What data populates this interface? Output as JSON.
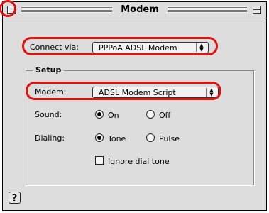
{
  "window": {
    "title": "Modem"
  },
  "connect": {
    "label": "Connect via:",
    "value": "PPPoA ADSL Modem"
  },
  "setup": {
    "title": "Setup",
    "modem_label": "Modem:",
    "modem_value": "ADSL Modem Script",
    "sound_label": "Sound:",
    "sound_options": [
      "On",
      "Off"
    ],
    "sound_selected": "On",
    "dialing_label": "Dialing:",
    "dialing_options": [
      "Tone",
      "Pulse"
    ],
    "dialing_selected": "Tone",
    "ignore_dial_tone": {
      "label": "Ignore dial tone",
      "checked": false
    }
  },
  "help": {
    "glyph": "?"
  },
  "annotation_color": "#e01212"
}
